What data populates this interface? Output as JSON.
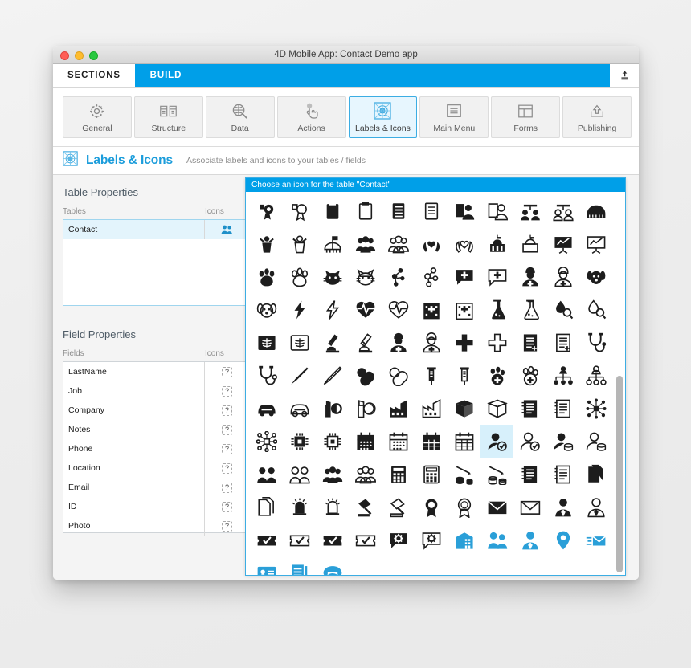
{
  "window": {
    "title": "4D Mobile App: Contact Demo app",
    "traffic_lights": [
      "close-button",
      "minimize-button",
      "zoom-button"
    ]
  },
  "tabs": [
    {
      "label": "SECTIONS",
      "active": true
    },
    {
      "label": "BUILD",
      "active": false
    }
  ],
  "tabstrip": {
    "upload_icon": "upload-icon"
  },
  "toolbar": [
    {
      "label": "General",
      "icon": "gear-icon",
      "selected": false
    },
    {
      "label": "Structure",
      "icon": "structure-icon",
      "selected": false
    },
    {
      "label": "Data",
      "icon": "data-search-icon",
      "selected": false
    },
    {
      "label": "Actions",
      "icon": "tap-hand-icon",
      "selected": false
    },
    {
      "label": "Labels & Icons",
      "icon": "labels-icons-icon",
      "selected": true
    },
    {
      "label": "Main Menu",
      "icon": "menu-list-icon",
      "selected": false
    },
    {
      "label": "Forms",
      "icon": "forms-layout-icon",
      "selected": false
    },
    {
      "label": "Publishing",
      "icon": "publish-upload-icon",
      "selected": false
    }
  ],
  "section": {
    "icon": "labels-icons-icon",
    "title": "Labels & Icons",
    "subtitle": "Associate labels and icons to your tables / fields"
  },
  "table_properties": {
    "heading": "Table Properties",
    "columns": [
      "Tables",
      "Icons"
    ],
    "rows": [
      {
        "name": "Contact",
        "icon": "two-people-blue-icon",
        "selected": true
      }
    ]
  },
  "field_properties": {
    "heading": "Field Properties",
    "columns": [
      "Fields",
      "Icons"
    ],
    "placeholder_glyph": "?",
    "rows": [
      {
        "name": "LastName",
        "icon": "placeholder-question-icon"
      },
      {
        "name": "Job",
        "icon": "placeholder-question-icon"
      },
      {
        "name": "Company",
        "icon": "placeholder-question-icon"
      },
      {
        "name": "Notes",
        "icon": "placeholder-question-icon"
      },
      {
        "name": "Phone",
        "icon": "placeholder-question-icon"
      },
      {
        "name": "Location",
        "icon": "placeholder-question-icon"
      },
      {
        "name": "Email",
        "icon": "placeholder-question-icon"
      },
      {
        "name": "ID",
        "icon": "placeholder-question-icon"
      },
      {
        "name": "Photo",
        "icon": "placeholder-question-icon"
      }
    ]
  },
  "icon_picker": {
    "title": "Choose an icon for the table \"Contact\"",
    "columns": 11,
    "selected_index": 84,
    "icons": [
      {
        "name": "badge-filled-icon",
        "style": "filled",
        "color": "#1d1d1d"
      },
      {
        "name": "badge-outline-icon",
        "style": "outline",
        "color": "#1d1d1d"
      },
      {
        "name": "clipboard-filled-icon",
        "style": "filled",
        "color": "#1d1d1d"
      },
      {
        "name": "clipboard-outline-icon",
        "style": "outline",
        "color": "#1d1d1d"
      },
      {
        "name": "list-filled-icon",
        "style": "filled",
        "color": "#1d1d1d"
      },
      {
        "name": "list-outline-icon",
        "style": "outline",
        "color": "#1d1d1d"
      },
      {
        "name": "profile-card-filled-icon",
        "style": "filled",
        "color": "#1d1d1d"
      },
      {
        "name": "profile-card-outline-icon",
        "style": "outline",
        "color": "#1d1d1d"
      },
      {
        "name": "two-users-network-filled-icon",
        "style": "filled",
        "color": "#1d1d1d"
      },
      {
        "name": "two-users-network-outline-icon",
        "style": "outline",
        "color": "#1d1d1d"
      },
      {
        "name": "stadium-filled-icon",
        "style": "filled",
        "color": "#1d1d1d"
      },
      {
        "name": "cheer-filled-icon",
        "style": "filled",
        "color": "#1d1d1d"
      },
      {
        "name": "cheer-outline-icon",
        "style": "outline",
        "color": "#1d1d1d"
      },
      {
        "name": "golf-flag-icon",
        "style": "outline",
        "color": "#1d1d1d"
      },
      {
        "name": "group-filled-icon",
        "style": "filled",
        "color": "#1d1d1d"
      },
      {
        "name": "group-outline-icon",
        "style": "outline",
        "color": "#1d1d1d"
      },
      {
        "name": "heart-hands-filled-icon",
        "style": "filled",
        "color": "#1d1d1d"
      },
      {
        "name": "heart-hands-outline-icon",
        "style": "outline",
        "color": "#1d1d1d"
      },
      {
        "name": "capitol-filled-icon",
        "style": "filled",
        "color": "#1d1d1d"
      },
      {
        "name": "capitol-outline-icon",
        "style": "outline",
        "color": "#1d1d1d"
      },
      {
        "name": "chart-board-filled-icon",
        "style": "filled",
        "color": "#1d1d1d"
      },
      {
        "name": "chart-board-outline-icon",
        "style": "outline",
        "color": "#1d1d1d"
      },
      {
        "name": "paw-filled-icon",
        "style": "filled",
        "color": "#1d1d1d"
      },
      {
        "name": "paw-outline-icon",
        "style": "outline",
        "color": "#1d1d1d"
      },
      {
        "name": "cat-filled-icon",
        "style": "filled",
        "color": "#1d1d1d"
      },
      {
        "name": "cat-outline-icon",
        "style": "outline",
        "color": "#1d1d1d"
      },
      {
        "name": "molecule-filled-icon",
        "style": "filled",
        "color": "#1d1d1d"
      },
      {
        "name": "molecule-outline-icon",
        "style": "outline",
        "color": "#1d1d1d"
      },
      {
        "name": "chat-plus-filled-icon",
        "style": "filled",
        "color": "#1d1d1d"
      },
      {
        "name": "chat-plus-outline-icon",
        "style": "outline",
        "color": "#1d1d1d"
      },
      {
        "name": "nurse-filled-icon",
        "style": "filled",
        "color": "#1d1d1d"
      },
      {
        "name": "nurse-outline-icon",
        "style": "outline",
        "color": "#1d1d1d"
      },
      {
        "name": "dog-face-filled-icon",
        "style": "filled",
        "color": "#1d1d1d"
      },
      {
        "name": "dog-face-outline-icon",
        "style": "outline",
        "color": "#1d1d1d"
      },
      {
        "name": "bolt-filled-icon",
        "style": "filled",
        "color": "#1d1d1d"
      },
      {
        "name": "bolt-outline-icon",
        "style": "outline",
        "color": "#1d1d1d"
      },
      {
        "name": "heartbeat-filled-icon",
        "style": "filled",
        "color": "#1d1d1d"
      },
      {
        "name": "heartbeat-outline-icon",
        "style": "outline",
        "color": "#1d1d1d"
      },
      {
        "name": "hospital-filled-icon",
        "style": "filled",
        "color": "#1d1d1d"
      },
      {
        "name": "hospital-outline-icon",
        "style": "outline",
        "color": "#1d1d1d"
      },
      {
        "name": "flask-filled-icon",
        "style": "filled",
        "color": "#1d1d1d"
      },
      {
        "name": "flask-outline-icon",
        "style": "outline",
        "color": "#1d1d1d"
      },
      {
        "name": "blood-drop-search-filled-icon",
        "style": "filled",
        "color": "#1d1d1d"
      },
      {
        "name": "blood-drop-search-outline-icon",
        "style": "outline",
        "color": "#1d1d1d"
      },
      {
        "name": "xray-filled-icon",
        "style": "filled",
        "color": "#1d1d1d"
      },
      {
        "name": "xray-outline-icon",
        "style": "outline",
        "color": "#1d1d1d"
      },
      {
        "name": "microscope-filled-icon",
        "style": "filled",
        "color": "#1d1d1d"
      },
      {
        "name": "microscope-outline-icon",
        "style": "outline",
        "color": "#1d1d1d"
      },
      {
        "name": "patient-filled-icon",
        "style": "filled",
        "color": "#1d1d1d"
      },
      {
        "name": "patient-outline-icon",
        "style": "outline",
        "color": "#1d1d1d"
      },
      {
        "name": "medical-cross-filled-icon",
        "style": "filled",
        "color": "#1d1d1d"
      },
      {
        "name": "medical-cross-outline-icon",
        "style": "outline",
        "color": "#1d1d1d"
      },
      {
        "name": "medical-record-filled-icon",
        "style": "filled",
        "color": "#1d1d1d"
      },
      {
        "name": "medical-record-outline-icon",
        "style": "outline",
        "color": "#1d1d1d"
      },
      {
        "name": "stethoscope-filled-icon",
        "style": "filled",
        "color": "#1d1d1d"
      },
      {
        "name": "stethoscope-outline-icon",
        "style": "outline",
        "color": "#1d1d1d"
      },
      {
        "name": "scalpel-filled-icon",
        "style": "filled",
        "color": "#1d1d1d"
      },
      {
        "name": "scalpel-outline-icon",
        "style": "outline",
        "color": "#1d1d1d"
      },
      {
        "name": "pills-filled-icon",
        "style": "filled",
        "color": "#1d1d1d"
      },
      {
        "name": "pills-outline-icon",
        "style": "outline",
        "color": "#1d1d1d"
      },
      {
        "name": "syringe-filled-icon",
        "style": "filled",
        "color": "#1d1d1d"
      },
      {
        "name": "syringe-outline-icon",
        "style": "outline",
        "color": "#1d1d1d"
      },
      {
        "name": "paw-cross-filled-icon",
        "style": "filled",
        "color": "#1d1d1d"
      },
      {
        "name": "paw-cross-outline-icon",
        "style": "outline",
        "color": "#1d1d1d"
      },
      {
        "name": "org-chart-filled-icon",
        "style": "filled",
        "color": "#1d1d1d"
      },
      {
        "name": "org-chart-outline-icon",
        "style": "outline",
        "color": "#1d1d1d"
      },
      {
        "name": "car-filled-icon",
        "style": "filled",
        "color": "#1d1d1d"
      },
      {
        "name": "car-outline-icon",
        "style": "outline",
        "color": "#1d1d1d"
      },
      {
        "name": "lipstick-filled-icon",
        "style": "filled",
        "color": "#1d1d1d"
      },
      {
        "name": "lipstick-outline-icon",
        "style": "outline",
        "color": "#1d1d1d"
      },
      {
        "name": "factory-filled-icon",
        "style": "filled",
        "color": "#1d1d1d"
      },
      {
        "name": "factory-outline-icon",
        "style": "outline",
        "color": "#1d1d1d"
      },
      {
        "name": "box-filled-icon",
        "style": "filled",
        "color": "#1d1d1d"
      },
      {
        "name": "box-outline-icon",
        "style": "outline",
        "color": "#1d1d1d"
      },
      {
        "name": "notebook-filled-icon",
        "style": "filled",
        "color": "#1d1d1d"
      },
      {
        "name": "notebook-outline-icon",
        "style": "outline",
        "color": "#1d1d1d"
      },
      {
        "name": "network-nodes-filled-icon",
        "style": "filled",
        "color": "#1d1d1d"
      },
      {
        "name": "network-nodes-outline-icon",
        "style": "outline",
        "color": "#1d1d1d"
      },
      {
        "name": "chip-filled-icon",
        "style": "filled",
        "color": "#1d1d1d"
      },
      {
        "name": "chip-outline-icon",
        "style": "outline",
        "color": "#1d1d1d"
      },
      {
        "name": "calendar-dots-filled-icon",
        "style": "filled",
        "color": "#1d1d1d"
      },
      {
        "name": "calendar-dots-outline-icon",
        "style": "outline",
        "color": "#1d1d1d"
      },
      {
        "name": "calendar-grid-filled-icon",
        "style": "filled",
        "color": "#1d1d1d"
      },
      {
        "name": "calendar-grid-outline-icon",
        "style": "outline",
        "color": "#1d1d1d"
      },
      {
        "name": "user-check-filled-icon",
        "style": "filled",
        "color": "#1d1d1d"
      },
      {
        "name": "user-check-outline-icon",
        "style": "outline",
        "color": "#1d1d1d"
      },
      {
        "name": "user-coins-filled-icon",
        "style": "filled",
        "color": "#1d1d1d"
      },
      {
        "name": "user-coins-outline-icon",
        "style": "outline",
        "color": "#1d1d1d"
      },
      {
        "name": "two-users-filled-icon",
        "style": "filled",
        "color": "#1d1d1d"
      },
      {
        "name": "two-users-outline-icon",
        "style": "outline",
        "color": "#1d1d1d"
      },
      {
        "name": "three-users-filled-icon",
        "style": "filled",
        "color": "#1d1d1d"
      },
      {
        "name": "three-users-outline-icon",
        "style": "outline",
        "color": "#1d1d1d"
      },
      {
        "name": "calculator-filled-icon",
        "style": "filled",
        "color": "#1d1d1d"
      },
      {
        "name": "calculator-outline-icon",
        "style": "outline",
        "color": "#1d1d1d"
      },
      {
        "name": "coins-arrow-filled-icon",
        "style": "filled",
        "color": "#1d1d1d"
      },
      {
        "name": "coins-arrow-outline-icon",
        "style": "outline",
        "color": "#1d1d1d"
      },
      {
        "name": "ledger-filled-icon",
        "style": "filled",
        "color": "#1d1d1d"
      },
      {
        "name": "ledger-outline-icon",
        "style": "outline",
        "color": "#1d1d1d"
      },
      {
        "name": "documents-filled-icon",
        "style": "filled",
        "color": "#1d1d1d"
      },
      {
        "name": "documents-outline-icon",
        "style": "outline",
        "color": "#1d1d1d"
      },
      {
        "name": "alarm-bell-filled-icon",
        "style": "filled",
        "color": "#1d1d1d"
      },
      {
        "name": "alarm-bell-outline-icon",
        "style": "outline",
        "color": "#1d1d1d"
      },
      {
        "name": "gavel-filled-icon",
        "style": "filled",
        "color": "#1d1d1d"
      },
      {
        "name": "gavel-outline-icon",
        "style": "outline",
        "color": "#1d1d1d"
      },
      {
        "name": "award-ribbon-filled-icon",
        "style": "filled",
        "color": "#1d1d1d"
      },
      {
        "name": "award-ribbon-outline-icon",
        "style": "outline",
        "color": "#1d1d1d"
      },
      {
        "name": "envelope-filled-icon",
        "style": "filled",
        "color": "#1d1d1d"
      },
      {
        "name": "envelope-outline-icon",
        "style": "outline",
        "color": "#1d1d1d"
      },
      {
        "name": "businessman-filled-icon",
        "style": "filled",
        "color": "#1d1d1d"
      },
      {
        "name": "businessman-outline-icon",
        "style": "outline",
        "color": "#1d1d1d"
      },
      {
        "name": "ticket-check-filled-icon",
        "style": "filled",
        "color": "#1d1d1d"
      },
      {
        "name": "ticket-check-outline-icon",
        "style": "outline",
        "color": "#1d1d1d"
      },
      {
        "name": "ticket-stub-check-filled-icon",
        "style": "filled",
        "color": "#1d1d1d"
      },
      {
        "name": "ticket-stub-check-outline-icon",
        "style": "outline",
        "color": "#1d1d1d"
      },
      {
        "name": "chat-gear-filled-icon",
        "style": "filled",
        "color": "#1d1d1d"
      },
      {
        "name": "chat-gear-outline-icon",
        "style": "outline",
        "color": "#1d1d1d"
      },
      {
        "name": "office-building-blue-icon",
        "style": "filled",
        "color": "#2a9fd8"
      },
      {
        "name": "two-people-blue-icon",
        "style": "filled",
        "color": "#2a9fd8"
      },
      {
        "name": "businessman-blue-icon",
        "style": "filled",
        "color": "#2a9fd8"
      },
      {
        "name": "map-pin-blue-icon",
        "style": "filled",
        "color": "#2a9fd8"
      },
      {
        "name": "send-mail-blue-icon",
        "style": "filled",
        "color": "#2a9fd8"
      },
      {
        "name": "id-badge-blue-icon",
        "style": "filled",
        "color": "#2a9fd8"
      },
      {
        "name": "notes-alert-blue-icon",
        "style": "filled",
        "color": "#2a9fd8"
      },
      {
        "name": "telephone-blue-icon",
        "style": "filled",
        "color": "#2a9fd8"
      }
    ]
  }
}
